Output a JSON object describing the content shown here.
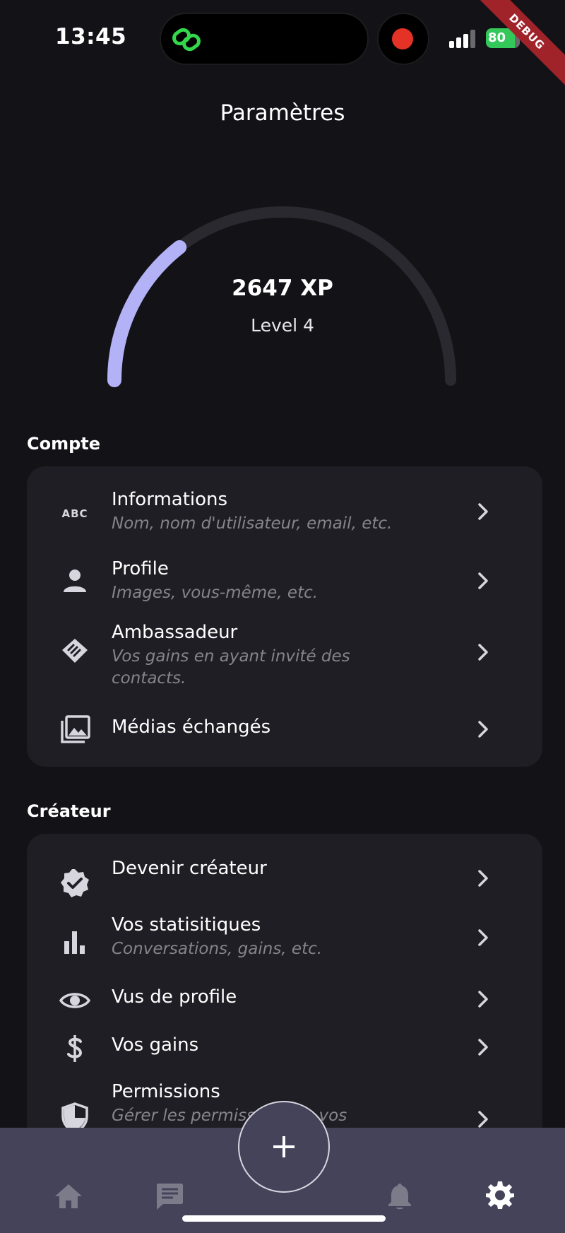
{
  "status_bar": {
    "time": "13:45",
    "battery": "80"
  },
  "debug_banner": "DEBUG",
  "header": {
    "title": "Paramètres"
  },
  "progress": {
    "xp": "2647 XP",
    "level": "Level 4",
    "fraction": 0.29,
    "track_color": "#2a2930",
    "fill_color": "#b3b2f7"
  },
  "sections": {
    "account": {
      "title": "Compte",
      "items": [
        {
          "title": "Informations",
          "subtitle": "Nom, nom d'utilisateur, email, etc.",
          "icon": "abc-icon"
        },
        {
          "title": "Profile",
          "subtitle": "Images, vous-même, etc.",
          "icon": "person-icon"
        },
        {
          "title": "Ambassadeur",
          "subtitle": "Vos gains en ayant invité des contacts.",
          "icon": "handshake-icon"
        },
        {
          "title": "Médias échangés",
          "subtitle": "",
          "icon": "photo-library-icon"
        }
      ]
    },
    "creator": {
      "title": "Créateur",
      "items": [
        {
          "title": "Devenir créateur",
          "subtitle": "",
          "icon": "verified-badge-icon"
        },
        {
          "title": "Vos statisitiques",
          "subtitle": "Conversations, gains, etc.",
          "icon": "bar-chart-icon"
        },
        {
          "title": "Vus de profile",
          "subtitle": "",
          "icon": "eye-icon"
        },
        {
          "title": "Vos gains",
          "subtitle": "",
          "icon": "dollar-icon"
        },
        {
          "title": "Permissions",
          "subtitle": "Gérer les permissions de vos conversations",
          "icon": "shield-icon"
        }
      ]
    }
  },
  "bottom_nav": {
    "items": [
      {
        "icon": "home-icon"
      },
      {
        "icon": "chat-icon"
      },
      {
        "icon": "add-icon"
      },
      {
        "icon": "bell-icon"
      },
      {
        "icon": "settings-icon"
      }
    ],
    "active_color": "#ffffff",
    "inactive_color": "#7c7b8a"
  }
}
